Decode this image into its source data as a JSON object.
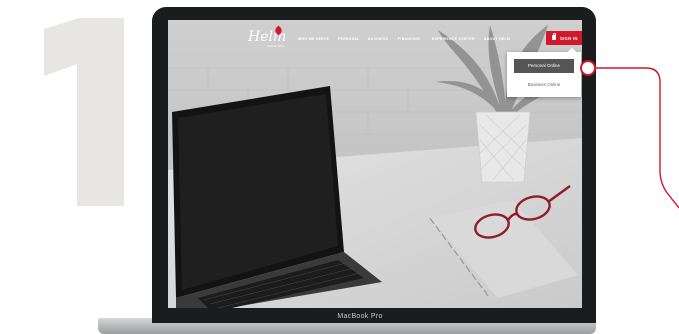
{
  "step": {
    "number": "1"
  },
  "device": {
    "label": "MacBook Pro"
  },
  "site": {
    "logo": {
      "text": "Helm",
      "subtext": "BANK USA"
    },
    "nav": [
      "WHO WE SERVE",
      "PERSONAL",
      "BUSINESS",
      "FINANCING",
      "EXPERIENCE CENTER",
      "ABOUT HELM"
    ],
    "signin": {
      "label": "SIGN IN"
    },
    "dropdown": {
      "items": [
        "Personal Online",
        "Business Online"
      ],
      "selected": "Personal Online"
    }
  },
  "colors": {
    "accent": "#d0192a",
    "step_number": "#e8e6e4",
    "callout": "#d0192a",
    "selected_item": "#555555"
  },
  "icons": {
    "signin": "lock-icon",
    "dropdown": "caret-icon"
  }
}
